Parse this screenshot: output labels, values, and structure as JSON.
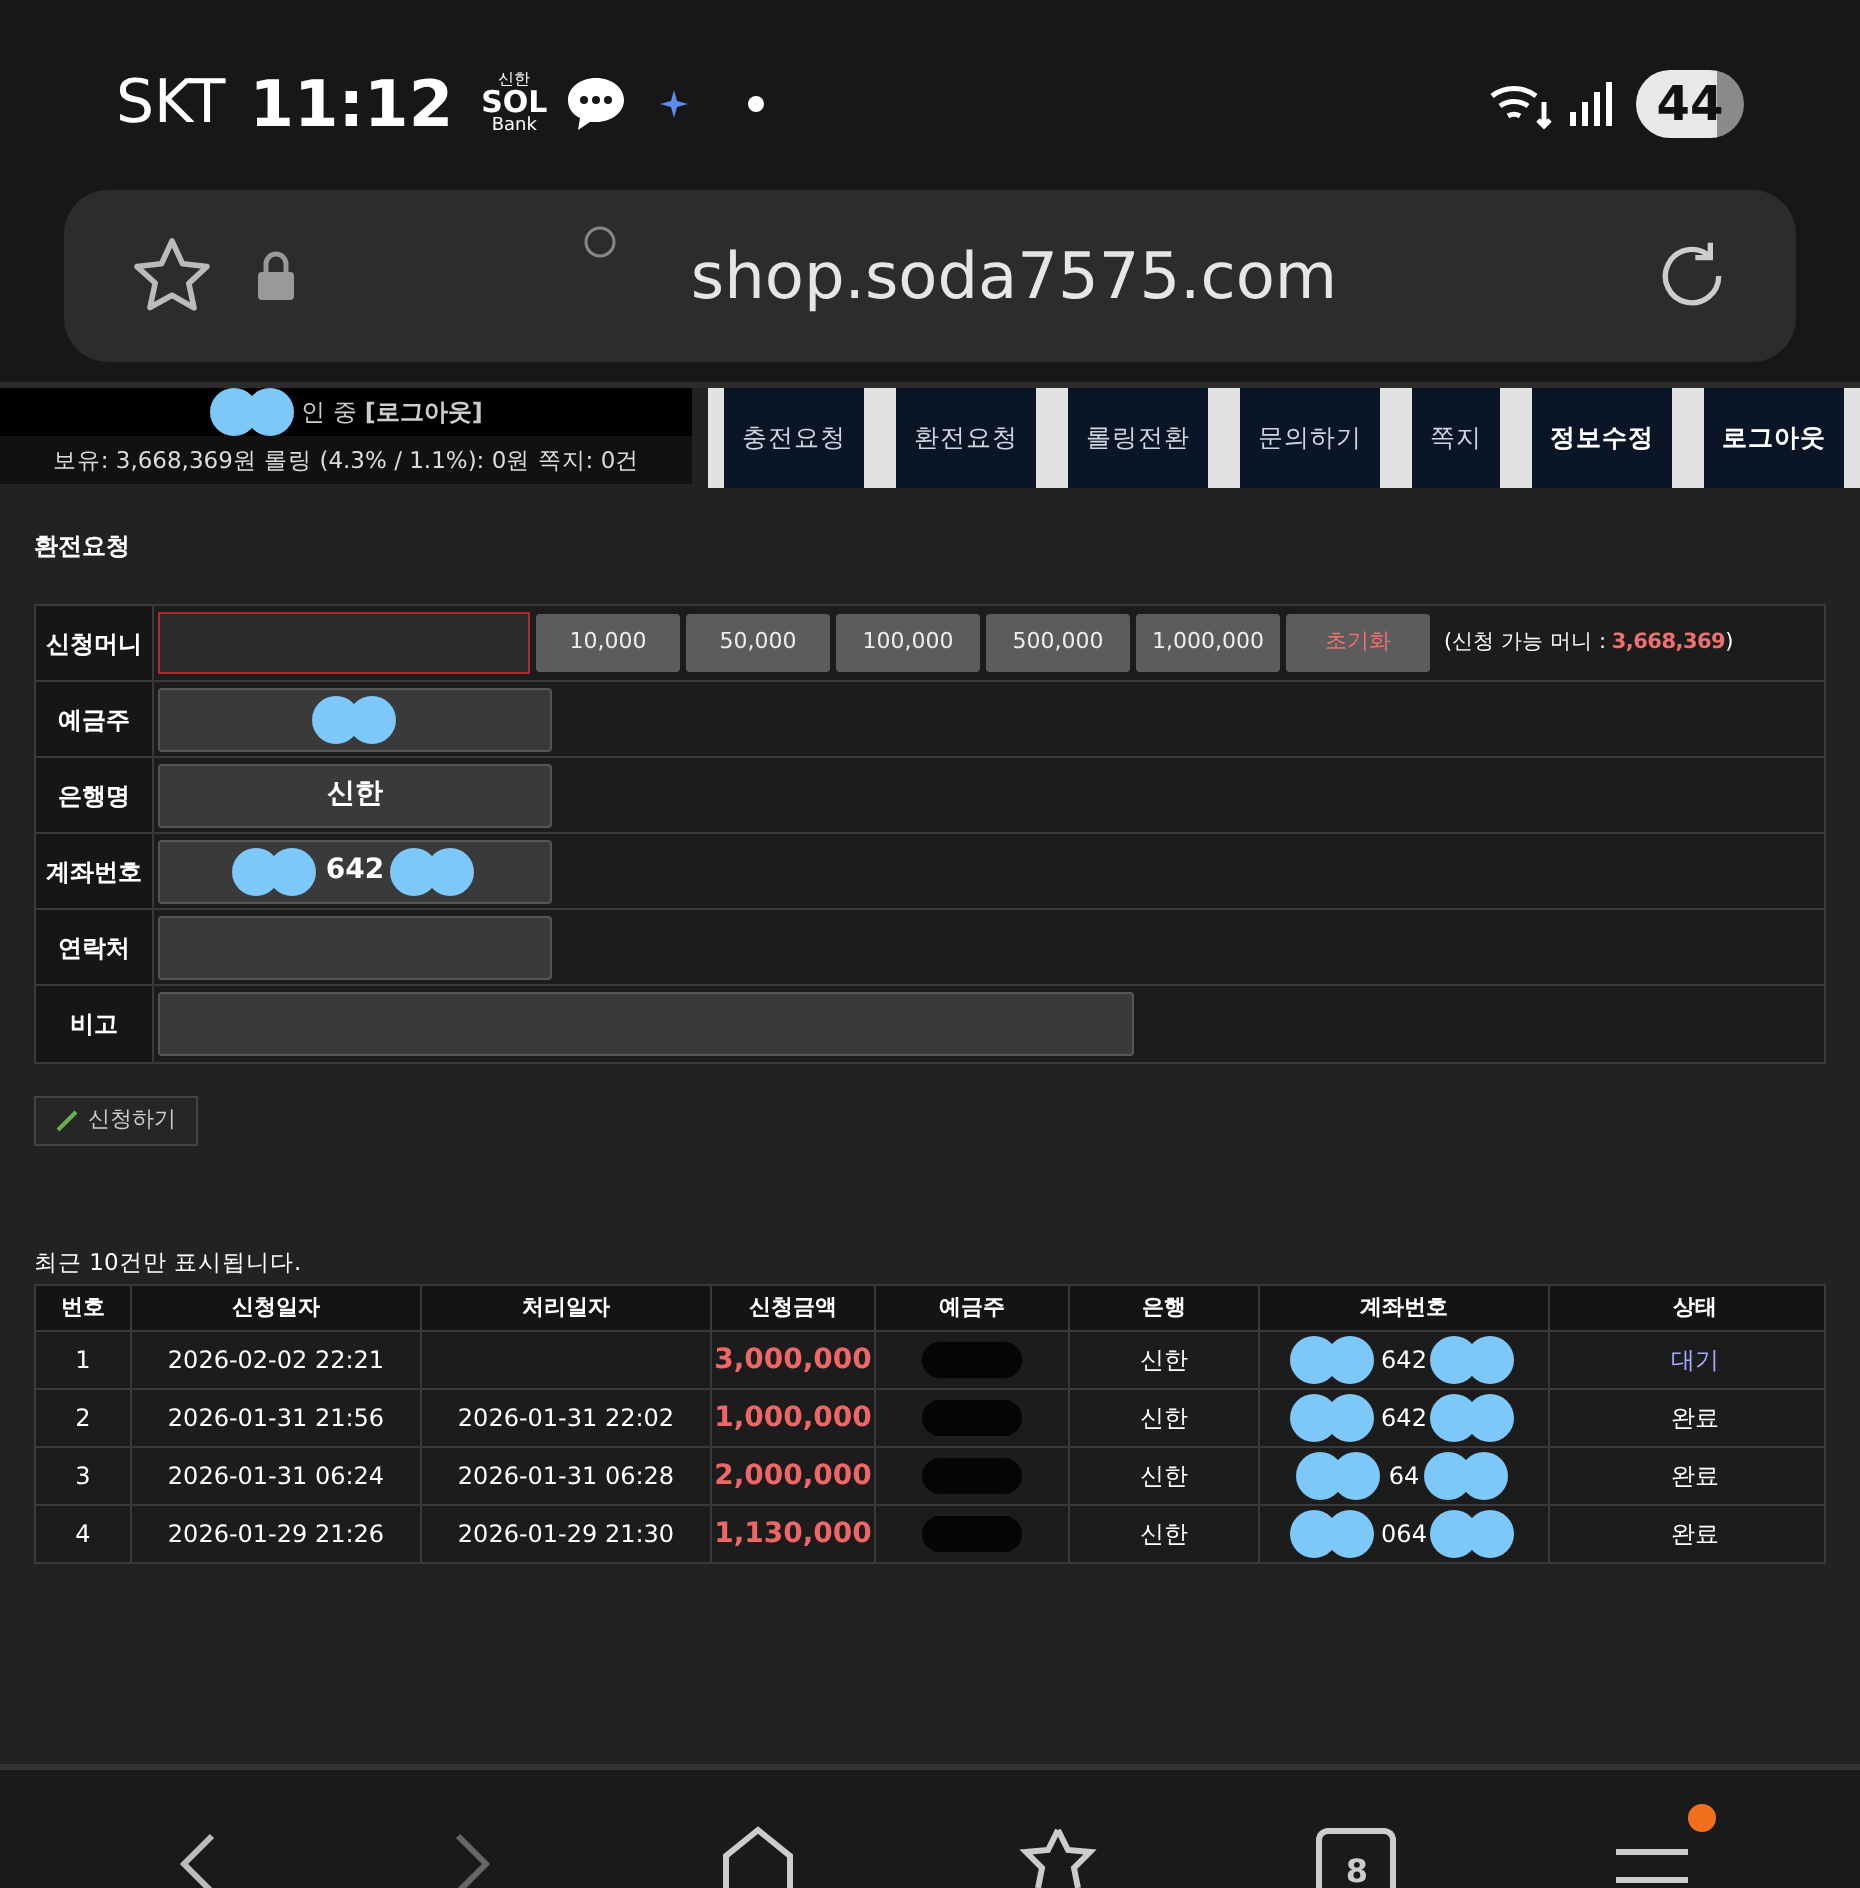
{
  "status_bar": {
    "carrier": "SKT",
    "time": "11:12",
    "app_logo": {
      "top": "신한",
      "middle": "SOL",
      "bottom": "Bank"
    },
    "battery": "44"
  },
  "url_bar": {
    "url": "shop.soda7575.com"
  },
  "account": {
    "login_status": "인 중 **[로그아웃]**",
    "summary": "보유: 3,668,369원 롤링 (4.3% / 1.1%): 0원 쪽지: 0건"
  },
  "menu": [
    {
      "label": "충전요청",
      "emphasized": false
    },
    {
      "label": "환전요청",
      "emphasized": false
    },
    {
      "label": "롤링전환",
      "emphasized": false
    },
    {
      "label": "문의하기",
      "emphasized": false
    },
    {
      "label": "쪽지",
      "emphasized": false
    },
    {
      "label": "정보수정",
      "emphasized": true
    },
    {
      "label": "로그아웃",
      "emphasized": true
    }
  ],
  "section_title": "환전요청",
  "form": [
    {
      "kind": "money",
      "label": "신청머니",
      "quick_amounts": [
        "10,000",
        "50,000",
        "100,000",
        "500,000",
        "1,000,000"
      ],
      "reset": "초기화",
      "available_label": "(신청 가능 머니 : ",
      "available_amount": "3,668,369",
      "available_end": ")"
    },
    {
      "kind": "field",
      "label": "예금주",
      "value_redacted": true
    },
    {
      "kind": "field",
      "label": "은행명",
      "value": "신한"
    },
    {
      "kind": "field",
      "label": "계좌번호",
      "value": "642",
      "value_redacted": true
    },
    {
      "kind": "field",
      "label": "연락처"
    },
    {
      "kind": "wide",
      "label": "비고"
    }
  ],
  "submit_button": "신청하기",
  "history_note": "최근 10건만 표시됩니다.",
  "history": {
    "columns": [
      "번호",
      "신청일자",
      "처리일자",
      "신청금액",
      "예금주",
      "은행",
      "계좌번호",
      "상태"
    ],
    "rows": [
      {
        "no": "1",
        "requested": "2026-02-02 22:21",
        "amount": "3,000,000",
        "bank": "신한",
        "account": "642",
        "status": "대기",
        "highlighted": true
      },
      {
        "no": "2",
        "requested": "2026-01-31 21:56",
        "processed": "2026-01-31 22:02",
        "amount": "1,000,000",
        "bank": "신한",
        "account": "642",
        "status": "완료",
        "highlighted": false
      },
      {
        "no": "3",
        "requested": "2026-01-31 06:24",
        "processed": "2026-01-31 06:28",
        "amount": "2,000,000",
        "bank": "신한",
        "account": "64",
        "status": "완료",
        "highlighted": false
      },
      {
        "no": "4",
        "requested": "2026-01-29 21:26",
        "processed": "2026-01-29 21:30",
        "amount": "1,130,000",
        "bank": "신한",
        "account": "064",
        "status": "완료",
        "highlighted": false
      }
    ]
  },
  "bottom_nav": {
    "tab_count": "8",
    "menu_badge": true
  }
}
